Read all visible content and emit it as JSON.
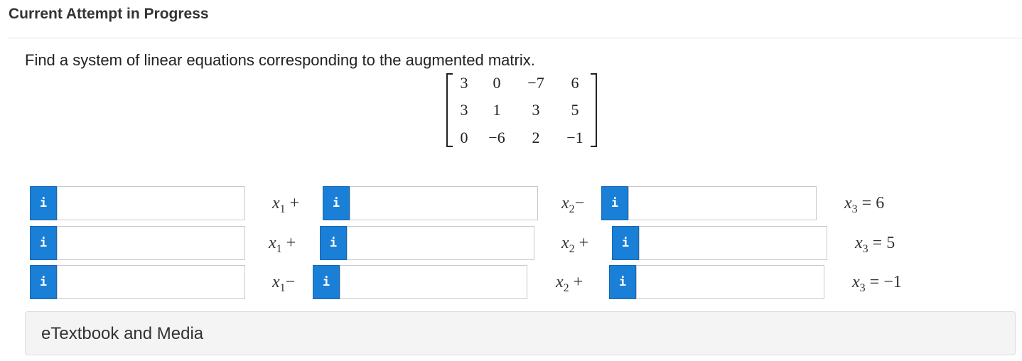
{
  "header": {
    "title": "Current Attempt in Progress"
  },
  "question": {
    "text": "Find a system of linear equations corresponding to the augmented matrix."
  },
  "matrix": {
    "rows": [
      [
        "3",
        "0",
        "−7",
        "6"
      ],
      [
        "3",
        "1",
        "3",
        "5"
      ],
      [
        "0",
        "−6",
        "2",
        "−1"
      ]
    ]
  },
  "equations": [
    {
      "x1": "x",
      "x1_sub": "1",
      "op1": "+",
      "x2": "x",
      "x2_sub": "2",
      "op2": "−",
      "x3": "x",
      "x3_sub": "3",
      "eq": "=",
      "rhs": "6"
    },
    {
      "x1": "x",
      "x1_sub": "1",
      "op1": "+",
      "x2": "x",
      "x2_sub": "2",
      "op2": "+",
      "x3": "x",
      "x3_sub": "3",
      "eq": "=",
      "rhs": "5"
    },
    {
      "x1": "x",
      "x1_sub": "1",
      "op1": "−",
      "x2": "x",
      "x2_sub": "2",
      "op2": "+",
      "x3": "x",
      "x3_sub": "3",
      "eq": "=",
      "rhs": "−1"
    }
  ],
  "info_button": {
    "label": "i",
    "icon": "info-icon",
    "color": "#1a7fd6"
  },
  "etextbook": {
    "label": "eTextbook and Media"
  }
}
